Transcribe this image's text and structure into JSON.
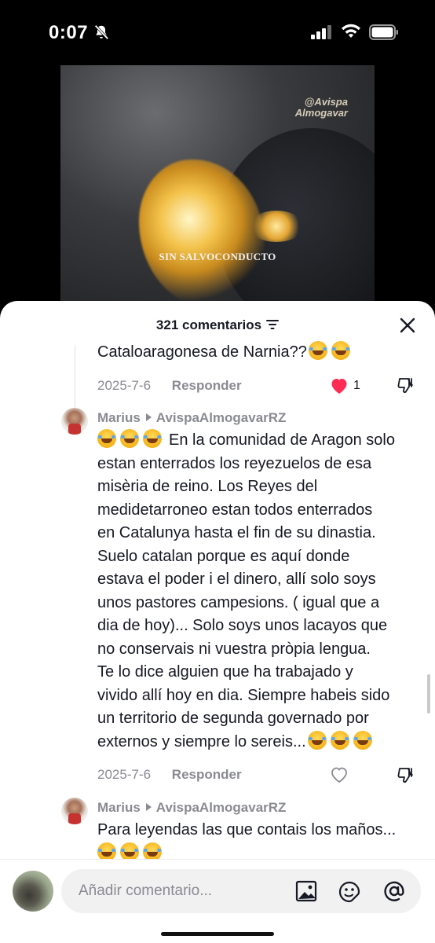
{
  "status_bar": {
    "time": "0:07"
  },
  "video": {
    "watermark_line1": "@Avispa",
    "watermark_line2": "Almogavar",
    "caption": "SIN SALVOCONDUCTO"
  },
  "comments_header": {
    "count_label": "321 comentarios"
  },
  "comments": [
    {
      "text_tail": "Cataloaragonesa de Narnia??",
      "emoji_count": 2,
      "date": "2025-7-6",
      "reply_label": "Responder",
      "likes": "1",
      "liked": true
    },
    {
      "username": "Marius",
      "reply_to": "AvispaAlmogavarRZ",
      "lines": [
        "En la comunidad de Aragon solo",
        "estan enterrados los reyezuelos de esa",
        "misèria de reino. Los Reyes del",
        "medidetarroneo estan todos enterrados",
        "en Catalunya hasta el fin de su dinastia.",
        "Suelo catalan porque es aquí donde",
        "estava el poder i el dinero, allí solo soys",
        "unos pastores campesions. ( igual que a",
        "dia de hoy)... Solo soys unos lacayos que",
        "no conservais ni vuestra pròpia lengua.",
        "Te lo dice alguien que ha trabajado y",
        "vivido allí hoy en dia. Siempre habeis sido",
        "un territorio de segunda governado por",
        "externos y siempre lo sereis..."
      ],
      "date": "2025-7-6",
      "reply_label": "Responder"
    },
    {
      "username": "Marius",
      "reply_to": "AvispaAlmogavarRZ",
      "text": "Para leyendas las que contais los maños..."
    }
  ],
  "input_bar": {
    "placeholder": "Añadir comentario..."
  },
  "colors": {
    "like_red": "#fe2c55",
    "text_gray": "#8a8b91",
    "text_dark": "#161823"
  }
}
